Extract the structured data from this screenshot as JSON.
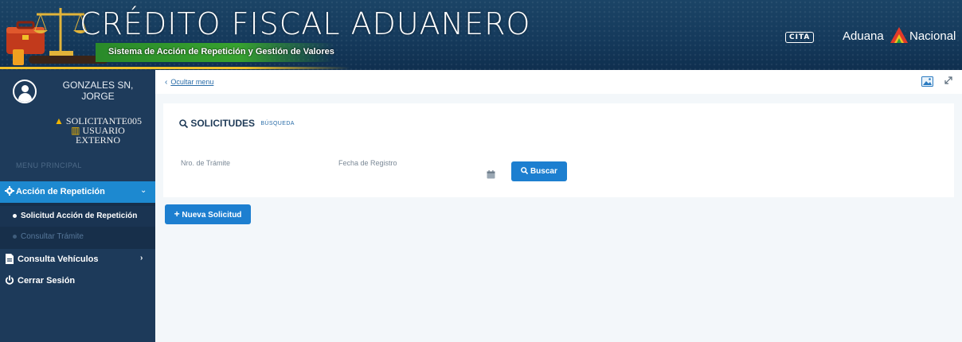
{
  "header": {
    "title": "CRÉDITO FISCAL ADUANERO",
    "subtitle": "Sistema de Acción de Repetición y Gestión de Valores",
    "cita_logo": "CITA",
    "aduana_logo_left": "Aduana",
    "aduana_logo_right": "Nacional"
  },
  "user": {
    "name": "GONZALES SN, JORGE",
    "id": "SOLICITANTE005",
    "type": "USUARIO EXTERNO"
  },
  "sidebar": {
    "menu_header": "MENU PRINCIPAL",
    "items": [
      {
        "label": "Acción de Repetición",
        "icon": "gear-icon",
        "expanded": true,
        "children": [
          {
            "label": "Solicitud Acción de Repetición",
            "active": true
          },
          {
            "label": "Consultar Trámite",
            "active": false
          }
        ]
      },
      {
        "label": "Consulta Vehículos",
        "icon": "file-icon"
      },
      {
        "label": "Cerrar Sesión",
        "icon": "power-icon"
      }
    ]
  },
  "topbar": {
    "hide_menu": "Ocultar menu"
  },
  "panel": {
    "title": "SOLICITUDES",
    "title_suffix": "BÚSQUEDA",
    "label_tramite": "Nro. de Trámite",
    "label_fecha": "Fecha de Registro",
    "search_button": "Buscar"
  },
  "actions": {
    "new_request": "Nueva Solicitud"
  },
  "colors": {
    "header_bg": "#153a5c",
    "sidebar_bg": "#1d3a5a",
    "accent_blue": "#1d89d0",
    "button_blue": "#1d7fd0",
    "banner_green": "#37a22f",
    "gold": "#f0c028"
  }
}
